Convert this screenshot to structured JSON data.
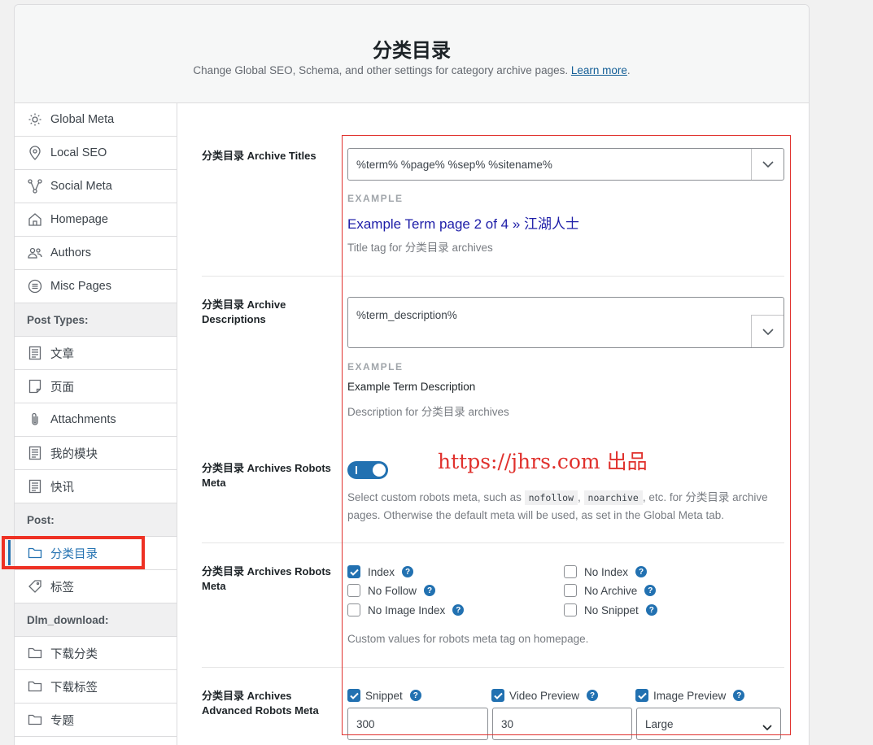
{
  "header": {
    "title": "分类目录",
    "subtitle": "Change Global SEO, Schema, and other settings for category archive pages.",
    "learn_more": "Learn more",
    "period": "."
  },
  "sidebar": {
    "items": [
      {
        "label": "Global Meta",
        "icon": "gear-icon"
      },
      {
        "label": "Local SEO",
        "icon": "location-pin-icon"
      },
      {
        "label": "Social Meta",
        "icon": "share-nodes-icon"
      },
      {
        "label": "Homepage",
        "icon": "home-icon"
      },
      {
        "label": "Authors",
        "icon": "users-icon"
      },
      {
        "label": "Misc Pages",
        "icon": "list-circle-icon"
      }
    ],
    "section_post_types": "Post Types:",
    "post_types": [
      {
        "label": "文章",
        "icon": "document-icon"
      },
      {
        "label": "页面",
        "icon": "page-icon"
      },
      {
        "label": "Attachments",
        "icon": "paperclip-icon"
      },
      {
        "label": "我的模块",
        "icon": "document-icon"
      },
      {
        "label": "快讯",
        "icon": "document-icon"
      }
    ],
    "section_post": "Post:",
    "post": [
      {
        "label": "分类目录",
        "icon": "folder-icon",
        "active": true
      },
      {
        "label": "标签",
        "icon": "tag-icon"
      }
    ],
    "section_dlm": "Dlm_download:",
    "dlm": [
      {
        "label": "下载分类",
        "icon": "folder-icon"
      },
      {
        "label": "下载标签",
        "icon": "folder-icon"
      },
      {
        "label": "专题",
        "icon": "folder-icon"
      }
    ]
  },
  "titles": {
    "label": "分类目录 Archive Titles",
    "value": "%term% %page% %sep% %sitename%",
    "example_label": "EXAMPLE",
    "example": "Example Term page 2 of 4 » 江湖人士",
    "description": "Title tag for 分类目录 archives"
  },
  "descriptions": {
    "label_line1": "分类目录 Archive",
    "label_line2": "Descriptions",
    "value": "%term_description%",
    "example_label": "EXAMPLE",
    "example": "Example Term Description",
    "description": "Description for 分类目录 archives"
  },
  "robots_toggle": {
    "label_line1": "分类目录 Archives Robots",
    "label_line2": "Meta",
    "desc_pre": "Select custom robots meta, such as",
    "code1": "nofollow",
    "comma": ",",
    "code2": "noarchive",
    "desc_mid": ", etc. for 分类目录 archive",
    "desc_line2": "pages. Otherwise the default meta will be used, as set in the Global Meta tab."
  },
  "robots_meta": {
    "label_line1": "分类目录 Archives Robots",
    "label_line2": "Meta",
    "checkboxes": {
      "index": {
        "label": "Index",
        "checked": true
      },
      "no_index": {
        "label": "No Index",
        "checked": false
      },
      "no_follow": {
        "label": "No Follow",
        "checked": false
      },
      "no_archive": {
        "label": "No Archive",
        "checked": false
      },
      "no_image_index": {
        "label": "No Image Index",
        "checked": false
      },
      "no_snippet": {
        "label": "No Snippet",
        "checked": false
      }
    },
    "description": "Custom values for robots meta tag on homepage."
  },
  "advanced": {
    "label_line1": "分类目录 Archives",
    "label_line2": "Advanced Robots Meta",
    "snippet_label": "Snippet",
    "video_label": "Video Preview",
    "image_label": "Image Preview",
    "snippet_value": "300",
    "video_value": "30",
    "image_value": "Large"
  },
  "watermark": "https://jhrs.com 出品",
  "help_glyph": "?",
  "colors": {
    "accent": "#2271b1",
    "highlight": "#ee3124",
    "link": "#1e1ea8"
  }
}
